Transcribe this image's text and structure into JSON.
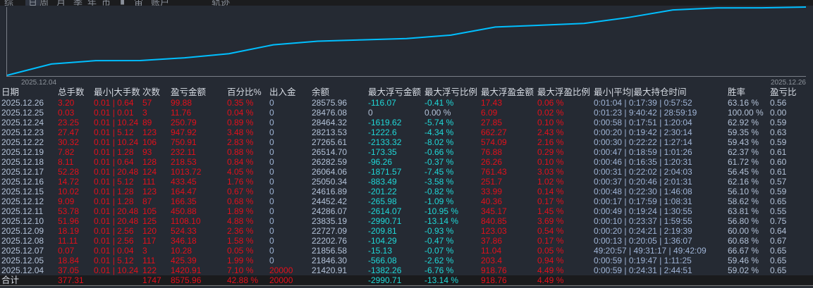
{
  "tabs": [
    "综",
    "日",
    "周",
    "月",
    "季",
    "年",
    "币",
    "▮",
    "宙",
    "账户",
    "轨迹"
  ],
  "active_tab": 1,
  "colors": {
    "background": "#252a33",
    "line": "#00bfff",
    "profit": "#e3101b",
    "drawdown": "#1fd8d8",
    "text": "#b3c2d8"
  },
  "chart_data": {
    "type": "line",
    "x_tick_labels": [
      "2025.12.04",
      "2025.12.26"
    ],
    "x": [
      "2025.12.04",
      "2025.12.05",
      "2025.12.07",
      "2025.12.08",
      "2025.12.09",
      "2025.12.10",
      "2025.12.11",
      "2025.12.12",
      "2025.12.15",
      "2025.12.16",
      "2025.12.17",
      "2025.12.18",
      "2025.12.19",
      "2025.12.22",
      "2025.12.23",
      "2025.12.24",
      "2025.12.25",
      "2025.12.26"
    ],
    "values": [
      21420.91,
      21846.3,
      21856.58,
      22202.76,
      22727.09,
      23835.19,
      24286.07,
      24452.42,
      24616.89,
      25050.34,
      26064.06,
      26282.59,
      26514.7,
      27265.61,
      28213.53,
      28464.32,
      28476.08,
      28575.96
    ],
    "start_value": 20000,
    "grid": false
  },
  "table": {
    "headers": [
      "日期",
      "总手数",
      "最小|大手数",
      "次数",
      "盈亏金额",
      "百分比%",
      "出入金",
      "余额",
      "最大浮亏金额",
      "最大浮亏比例",
      "最大浮盈金额",
      "最大浮盈比例",
      "最小|平均|最大持仓时间",
      "胜率",
      "盈亏比"
    ],
    "rows": [
      [
        "2025.12.26",
        "3.20",
        "0.01 | 0.64",
        "57",
        "99.88",
        "0.35 %",
        "0",
        "28575.96",
        "-116.07",
        "-0.41 %",
        "17.43",
        "0.06 %",
        "0:01:04 | 0:17:39 | 0:57:52",
        "63.16 %",
        "0.56"
      ],
      [
        "2025.12.25",
        "0.03",
        "0.01 | 0.01",
        "3",
        "11.76",
        "0.04 %",
        "0",
        "28476.08",
        "0",
        "0.00 %",
        "6.09",
        "0.02 %",
        "0:01:23 | 9:40:42 | 28:59:19",
        "100.00 %",
        "0.00"
      ],
      [
        "2025.12.24",
        "23.25",
        "0.01 | 10.24",
        "89",
        "250.79",
        "0.89 %",
        "0",
        "28464.32",
        "-1619.62",
        "-5.74 %",
        "27.85",
        "0.10 %",
        "0:00:58 | 0:17:51 | 1:20:04",
        "62.92 %",
        "0.59"
      ],
      [
        "2025.12.23",
        "27.47",
        "0.01 | 5.12",
        "123",
        "947.92",
        "3.48 %",
        "0",
        "28213.53",
        "-1222.6",
        "-4.34 %",
        "662.27",
        "2.43 %",
        "0:00:20 | 0:19:42 | 2:30:14",
        "59.35 %",
        "0.63"
      ],
      [
        "2025.12.22",
        "30.32",
        "0.01 | 10.24",
        "106",
        "750.91",
        "2.83 %",
        "0",
        "27265.61",
        "-2133.32",
        "-8.02 %",
        "574.09",
        "2.16 %",
        "0:00:30 | 0:22:22 | 1:27:14",
        "59.43 %",
        "0.59"
      ],
      [
        "2025.12.19",
        "7.82",
        "0.01 | 1.28",
        "93",
        "232.11",
        "0.88 %",
        "0",
        "26514.70",
        "-173.35",
        "-0.66 %",
        "76.88",
        "0.29 %",
        "0:00:47 | 0:18:59 | 1:01:26",
        "62.37 %",
        "0.61"
      ],
      [
        "2025.12.18",
        "8.11",
        "0.01 | 0.64",
        "128",
        "218.53",
        "0.84 %",
        "0",
        "26282.59",
        "-96.26",
        "-0.37 %",
        "26.26",
        "0.10 %",
        "0:00:46 | 0:16:35 | 1:20:31",
        "61.72 %",
        "0.60"
      ],
      [
        "2025.12.17",
        "52.28",
        "0.01 | 20.48",
        "124",
        "1013.72",
        "4.05 %",
        "0",
        "26064.06",
        "-1871.57",
        "-7.45 %",
        "761.43",
        "3.03 %",
        "0:00:31 | 0:22:02 | 2:04:03",
        "56.45 %",
        "0.61"
      ],
      [
        "2025.12.16",
        "14.72",
        "0.01 | 5.12",
        "111",
        "433.45",
        "1.76 %",
        "0",
        "25050.34",
        "-883.49",
        "-3.58 %",
        "251.7",
        "1.02 %",
        "0:00:37 | 0:20:46 | 2:01:31",
        "62.16 %",
        "0.57"
      ],
      [
        "2025.12.15",
        "10.02",
        "0.01 | 1.28",
        "123",
        "164.47",
        "0.67 %",
        "0",
        "24616.89",
        "-201.22",
        "-0.82 %",
        "33.99",
        "0.14 %",
        "0:00:48 | 0:22:30 | 1:46:08",
        "56.10 %",
        "0.59"
      ],
      [
        "2025.12.12",
        "9.09",
        "0.01 | 1.28",
        "87",
        "166.35",
        "0.68 %",
        "0",
        "24452.42",
        "-265.98",
        "-1.09 %",
        "40.36",
        "0.17 %",
        "0:00:17 | 0:17:59 | 1:08:31",
        "58.62 %",
        "0.65"
      ],
      [
        "2025.12.11",
        "53.78",
        "0.01 | 20.48",
        "105",
        "450.88",
        "1.89 %",
        "0",
        "24286.07",
        "-2614.07",
        "-10.95 %",
        "345.17",
        "1.45 %",
        "0:00:49 | 0:19:24 | 1:30:55",
        "63.81 %",
        "0.55"
      ],
      [
        "2025.12.10",
        "51.96",
        "0.01 | 20.48",
        "125",
        "1108.10",
        "4.88 %",
        "0",
        "23835.19",
        "-2990.71",
        "-13.14 %",
        "840.85",
        "3.69 %",
        "0:00:10 | 0:23:37 | 1:59:55",
        "56.80 %",
        "0.75"
      ],
      [
        "2025.12.09",
        "18.19",
        "0.01 | 2.56",
        "120",
        "524.33",
        "2.36 %",
        "0",
        "22727.09",
        "-209.81",
        "-0.93 %",
        "123.03",
        "0.54 %",
        "0:00:20 | 0:24:21 | 2:19:39",
        "60.00 %",
        "0.64"
      ],
      [
        "2025.12.08",
        "11.11",
        "0.01 | 2.56",
        "117",
        "346.18",
        "1.58 %",
        "0",
        "22202.76",
        "-104.29",
        "-0.47 %",
        "37.86",
        "0.17 %",
        "0:00:13 | 0:20:05 | 1:36:07",
        "60.68 %",
        "0.67"
      ],
      [
        "2025.12.07",
        "0.07",
        "0.01 | 0.04",
        "3",
        "10.28",
        "0.05 %",
        "0",
        "21856.58",
        "-15.13",
        "-0.07 %",
        "11.04",
        "0.05 %",
        "49:20:57 | 49:31:17 | 49:42:09",
        "66.67 %",
        "0.65"
      ],
      [
        "2025.12.05",
        "18.84",
        "0.01 | 5.12",
        "111",
        "425.39",
        "1.99 %",
        "0",
        "21846.30",
        "-566.08",
        "-2.62 %",
        "203.4",
        "0.94 %",
        "0:00:59 | 0:19:47 | 1:11:25",
        "59.46 %",
        "0.65"
      ],
      [
        "2025.12.04",
        "37.05",
        "0.01 | 10.24",
        "122",
        "1420.91",
        "7.10 %",
        "20000",
        "21420.91",
        "-1382.26",
        "-6.76 %",
        "918.76",
        "4.49 %",
        "0:00:59 | 0:24:31 | 2:44:51",
        "59.02 %",
        "0.65"
      ]
    ],
    "total": [
      "合计",
      "377.31",
      "",
      "1747",
      "8575.96",
      "42.88 %",
      "20000",
      "",
      "-2990.71",
      "-13.14 %",
      "918.76",
      "4.49 %",
      "",
      "",
      ""
    ]
  }
}
